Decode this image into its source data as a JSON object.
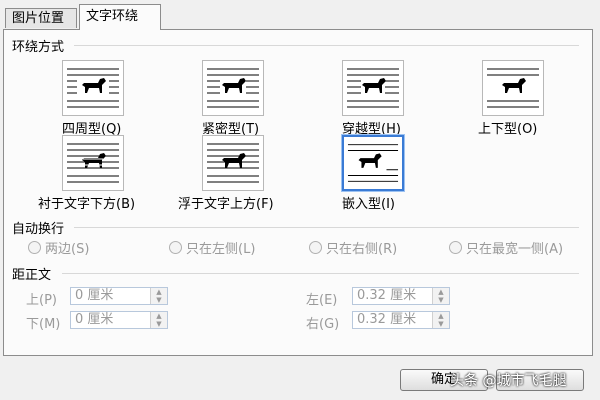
{
  "tabs": [
    {
      "label": "图片位置"
    },
    {
      "label": "文字环绕"
    }
  ],
  "wrap_section": {
    "title": "环绕方式",
    "options": [
      {
        "label": "四周型(Q)",
        "icon": "wrap-square-icon"
      },
      {
        "label": "紧密型(T)",
        "icon": "wrap-tight-icon"
      },
      {
        "label": "穿越型(H)",
        "icon": "wrap-through-icon"
      },
      {
        "label": "上下型(O)",
        "icon": "wrap-top-bottom-icon"
      },
      {
        "label": "衬于文字下方(B)",
        "icon": "wrap-behind-text-icon"
      },
      {
        "label": "浮于文字上方(F)",
        "icon": "wrap-in-front-icon"
      },
      {
        "label": "嵌入型(I)",
        "icon": "wrap-inline-icon",
        "selected": true
      }
    ]
  },
  "auto_wrap": {
    "title": "自动换行",
    "options": [
      {
        "label": "两边(S)"
      },
      {
        "label": "只在左侧(L)"
      },
      {
        "label": "只在右侧(R)"
      },
      {
        "label": "只在最宽一侧(A)"
      }
    ]
  },
  "distance": {
    "title": "距正文",
    "top": {
      "label": "上(P)",
      "value": "0 厘米"
    },
    "bottom": {
      "label": "下(M)",
      "value": "0 厘米"
    },
    "left": {
      "label": "左(E)",
      "value": "0.32 厘米"
    },
    "right": {
      "label": "右(G)",
      "value": "0.32 厘米"
    }
  },
  "buttons": {
    "ok": "确定"
  },
  "watermark": "头条 @城市飞毛腿",
  "colors": {
    "selected_border": "#3a7bd5",
    "disabled_text": "#9a9a9a"
  }
}
